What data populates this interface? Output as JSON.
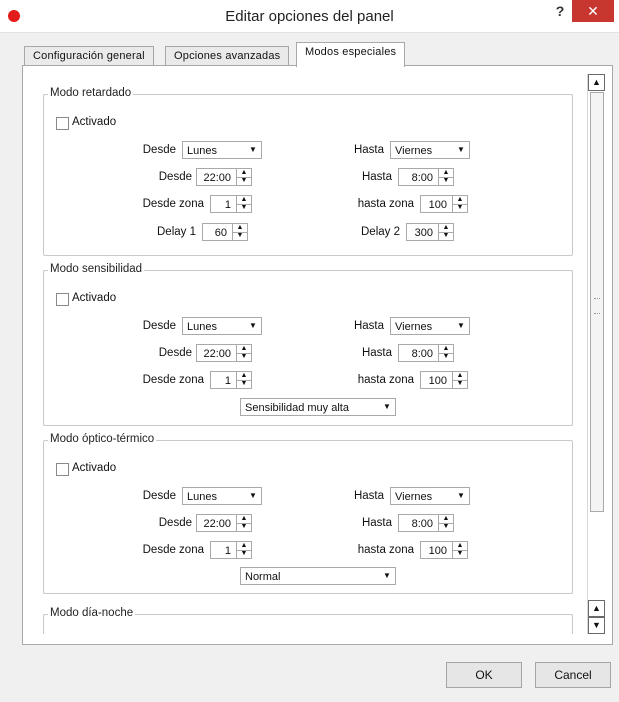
{
  "window": {
    "title": "Editar opciones del panel",
    "help_label": "?",
    "close_label": "✕"
  },
  "tabs": [
    {
      "label": "Configuración general"
    },
    {
      "label": "Opciones avanzadas"
    },
    {
      "label": "Modos especiales",
      "active": true
    }
  ],
  "groups": {
    "retardado": {
      "title": "Modo retardado",
      "activado": "Activado",
      "desde_dia_label": "Desde",
      "desde_dia": "Lunes",
      "hasta_dia_label": "Hasta",
      "hasta_dia": "Viernes",
      "desde_hora_label": "Desde",
      "desde_hora": "22:00",
      "hasta_hora_label": "Hasta",
      "hasta_hora": "8:00",
      "desde_zona_label": "Desde zona",
      "desde_zona": "1",
      "hasta_zona_label": "hasta zona",
      "hasta_zona": "100",
      "delay1_label": "Delay 1",
      "delay1": "60",
      "delay2_label": "Delay 2",
      "delay2": "300"
    },
    "sensibilidad": {
      "title": "Modo sensibilidad",
      "activado": "Activado",
      "desde_dia_label": "Desde",
      "desde_dia": "Lunes",
      "hasta_dia_label": "Hasta",
      "hasta_dia": "Viernes",
      "desde_hora_label": "Desde",
      "desde_hora": "22:00",
      "hasta_hora_label": "Hasta",
      "hasta_hora": "8:00",
      "desde_zona_label": "Desde zona",
      "desde_zona": "1",
      "hasta_zona_label": "hasta zona",
      "hasta_zona": "100",
      "nivel": "Sensibilidad muy alta"
    },
    "optico": {
      "title": "Modo óptico-térmico",
      "activado": "Activado",
      "desde_dia_label": "Desde",
      "desde_dia": "Lunes",
      "hasta_dia_label": "Hasta",
      "hasta_dia": "Viernes",
      "desde_hora_label": "Desde",
      "desde_hora": "22:00",
      "hasta_hora_label": "Hasta",
      "hasta_hora": "8:00",
      "desde_zona_label": "Desde zona",
      "desde_zona": "1",
      "hasta_zona_label": "hasta zona",
      "hasta_zona": "100",
      "modo": "Normal"
    },
    "dianoche": {
      "title": "Modo día-noche"
    }
  },
  "buttons": {
    "ok": "OK",
    "cancel": "Cancel"
  }
}
